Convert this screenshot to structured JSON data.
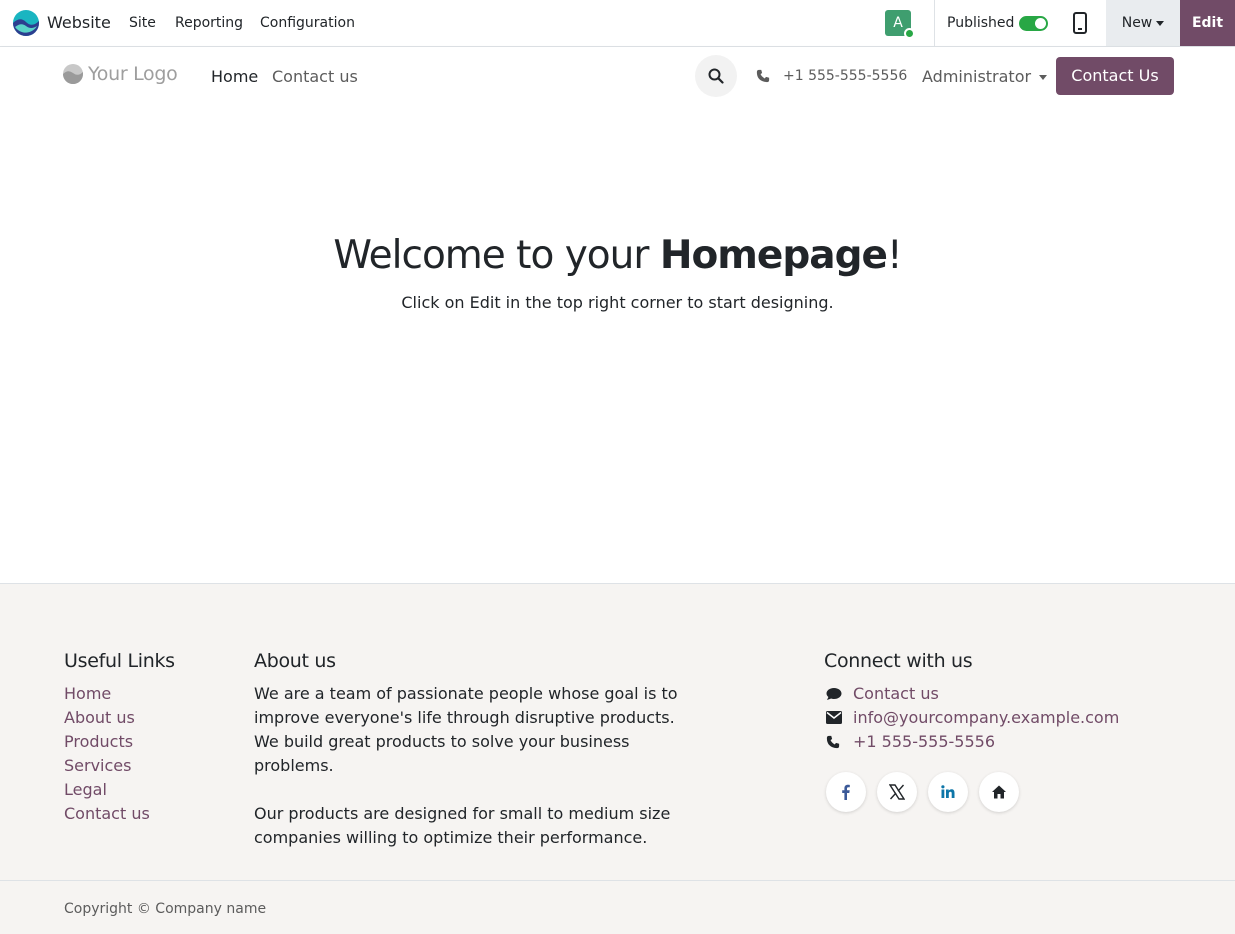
{
  "adminbar": {
    "app_name": "Website",
    "menu": [
      "Site",
      "Reporting",
      "Configuration"
    ],
    "avatar_letter": "A",
    "published_label": "Published",
    "published": true,
    "new_label": "New",
    "edit_label": "Edit"
  },
  "header": {
    "logo_text": "Your Logo",
    "nav": [
      "Home",
      "Contact us"
    ],
    "active_nav": "Home",
    "phone": "+1 555-555-5556",
    "user": "Administrator",
    "cta_label": "Contact Us"
  },
  "hero": {
    "title_prefix": "Welcome to your ",
    "title_bold": "Homepage",
    "title_suffix": "!",
    "subtitle_prefix": "Click on ",
    "subtitle_emphasis": "Edit",
    "subtitle_suffix": " in the top right corner to start designing."
  },
  "footer": {
    "useful_links": {
      "heading": "Useful Links",
      "items": [
        "Home",
        "About us",
        "Products",
        "Services",
        "Legal",
        "Contact us"
      ]
    },
    "about": {
      "heading": "About us",
      "paragraphs": [
        "We are a team of passionate people whose goal is to improve everyone's life through disruptive products. We build great products to solve your business problems.",
        "Our products are designed for small to medium size companies willing to optimize their performance."
      ]
    },
    "connect": {
      "heading": "Connect with us",
      "contact": "Contact us",
      "email": "info@yourcompany.example.com",
      "phone": "+1 555-555-5556",
      "socials": [
        "facebook-icon",
        "x-icon",
        "linkedin-icon",
        "home-icon"
      ]
    }
  },
  "copyright": "Copyright © Company name",
  "colors": {
    "brand": "#714b67",
    "toggle_on": "#28a745",
    "avatar_bg": "#3f9e6f",
    "footer_bg": "#f6f4f2"
  }
}
